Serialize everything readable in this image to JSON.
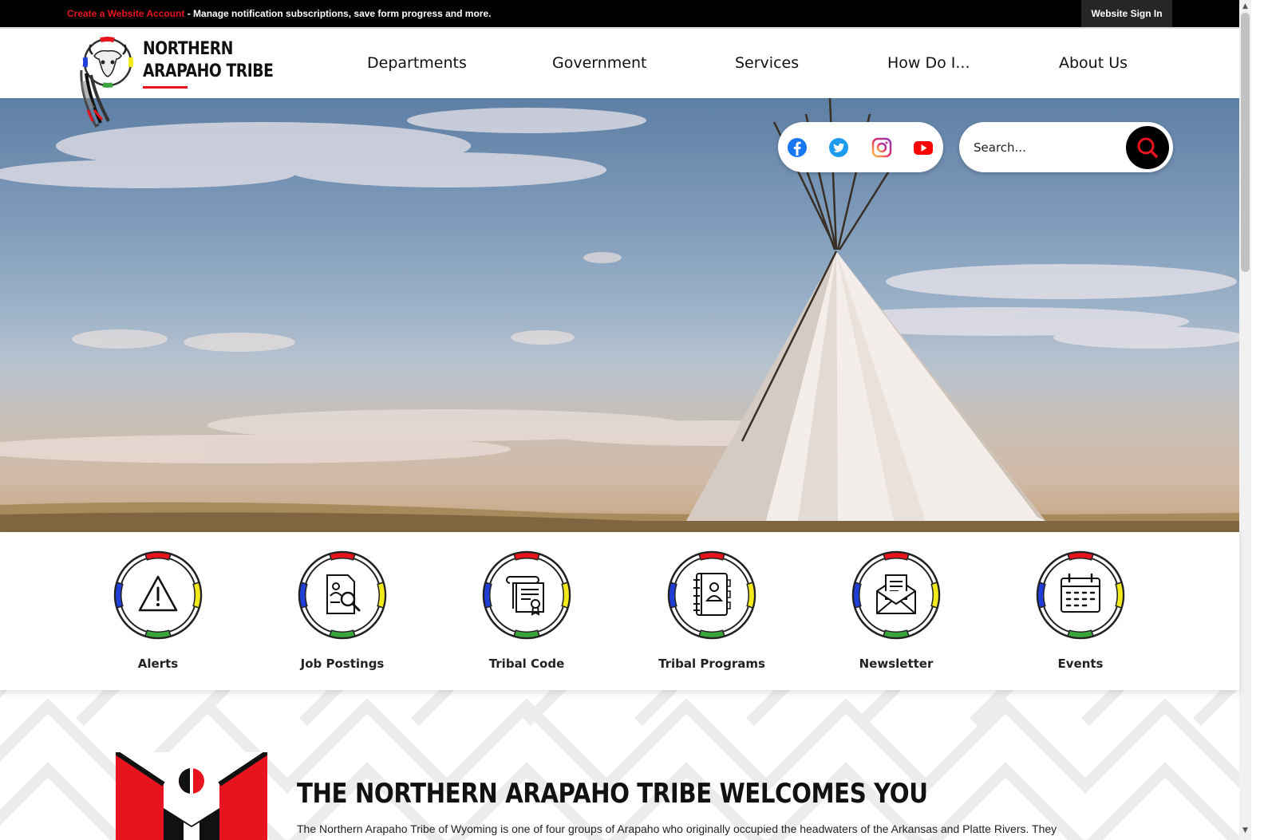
{
  "topbar": {
    "create_account": "Create a Website Account",
    "message": " - Manage notification subscriptions, save form progress and more.",
    "sign_in": "Website Sign In"
  },
  "header": {
    "logo_line1": "NORTHERN",
    "logo_line2": "ARAPAHO TRIBE",
    "nav": [
      "Departments",
      "Government",
      "Services",
      "How Do I...",
      "About Us"
    ]
  },
  "hero": {
    "social": [
      "facebook-icon",
      "twitter-icon",
      "instagram-icon",
      "youtube-icon"
    ],
    "search_placeholder": "Search..."
  },
  "quick_links": [
    {
      "label": "Alerts",
      "icon": "alert-icon"
    },
    {
      "label": "Job Postings",
      "icon": "job-search-icon"
    },
    {
      "label": "Tribal Code",
      "icon": "scroll-certificate-icon"
    },
    {
      "label": "Tribal Programs",
      "icon": "address-book-icon"
    },
    {
      "label": "Newsletter",
      "icon": "mail-letter-icon"
    },
    {
      "label": "Events",
      "icon": "calendar-icon"
    }
  ],
  "welcome": {
    "title": "THE NORTHERN ARAPAHO TRIBE WELCOMES YOU",
    "text": "The Northern Arapaho Tribe of Wyoming is one of four groups of Arapaho who originally occupied the headwaters of the Arkansas and Platte Rivers. They"
  },
  "colors": {
    "accent_red": "#e8141d",
    "ring_blue": "#1f3fd8",
    "ring_yellow": "#f3e91b",
    "ring_green": "#3aa53a"
  }
}
